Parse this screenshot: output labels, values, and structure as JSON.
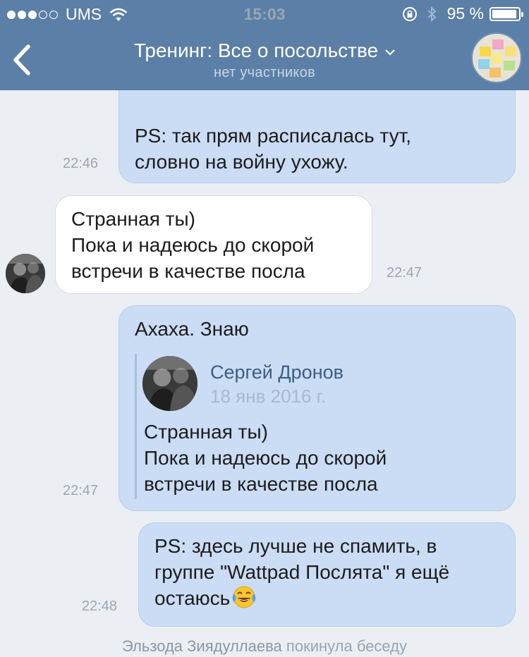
{
  "status_bar": {
    "carrier": "UMS",
    "time": "15:03",
    "battery": "95 %",
    "battery_level": 0.95
  },
  "header": {
    "title": "Тренинг: Все о посольстве",
    "subtitle": "нет участников",
    "back_icon": "chevron-left-icon",
    "avatar": "group-avatar"
  },
  "messages": [
    {
      "id": "m1",
      "direction": "out",
      "lines": [
        "PS: так прям расписалась тут,",
        "словно на войну ухожу."
      ],
      "time": "22:46"
    },
    {
      "id": "m2",
      "direction": "in",
      "lines": [
        "Странная ты)",
        "Пока и надеюсь до скорой",
        "встречи в качестве посла"
      ],
      "time": "22:47"
    },
    {
      "id": "m3",
      "direction": "out",
      "text": "Ахаха. Знаю",
      "reply": {
        "author": "Сергей Дронов",
        "date": "18 янв 2016 г.",
        "lines": [
          "Странная ты)",
          "Пока и надеюсь до скорой",
          "встречи в качестве посла"
        ]
      },
      "time": "22:47"
    },
    {
      "id": "m4",
      "direction": "out",
      "lines": [
        "PS: здесь лучше не спамить, в",
        "группе \"Wattpad Послята\" я ещё",
        "остаюсь"
      ],
      "emoji": "face-with-tears-of-joy-icon",
      "time": "22:48"
    }
  ],
  "service_message": {
    "user": "Эльзода Зиядуллаева",
    "action": "покинула беседу"
  },
  "colors": {
    "header": "#5b7fa6",
    "background": "#ebeff4",
    "outgoing_bubble": "#cbdcf5",
    "incoming_bubble": "#ffffff",
    "author": "#3d5d82"
  }
}
